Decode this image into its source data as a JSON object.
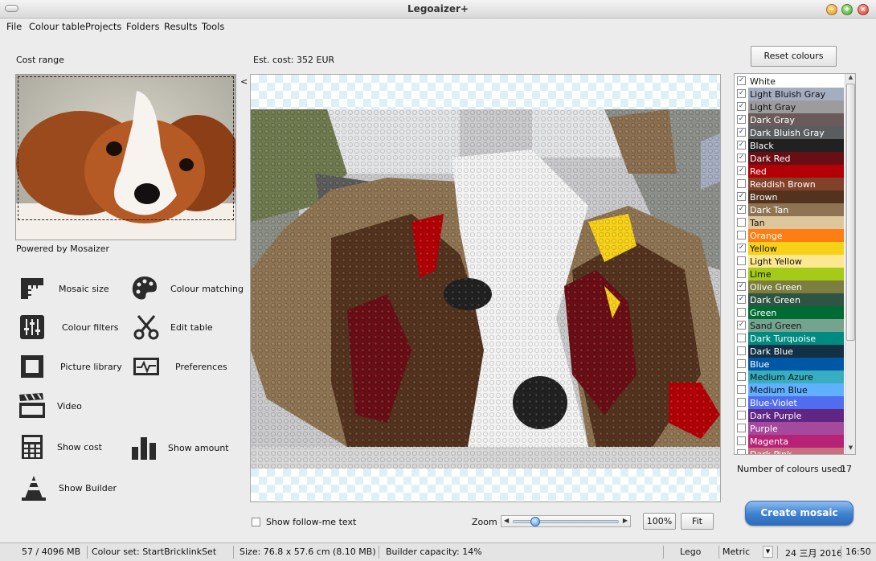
{
  "window": {
    "title": "Legoaizer+"
  },
  "menu": [
    "File",
    "Colour table",
    "Projects",
    "Folders",
    "Results",
    "Tools"
  ],
  "left": {
    "cost_range_label": "Cost range",
    "powered_by": "Powered by Mosaizer",
    "tools": [
      {
        "label": "Mosaic size",
        "icon": "ruler-icon"
      },
      {
        "label": "Colour matching",
        "icon": "palette-icon"
      },
      {
        "label": "Colour filters",
        "icon": "sliders-icon"
      },
      {
        "label": "Edit table",
        "icon": "scissors-icon"
      },
      {
        "label": "Picture library",
        "icon": "picture-frame-icon"
      },
      {
        "label": "Preferences",
        "icon": "monitor-pulse-icon"
      },
      {
        "label": "Video",
        "icon": "clapperboard-icon"
      },
      {
        "label": "Show cost",
        "icon": "calculator-icon"
      },
      {
        "label": "Show amount",
        "icon": "bar-chart-icon"
      },
      {
        "label": "Show Builder",
        "icon": "traffic-cone-icon"
      }
    ]
  },
  "center": {
    "est_cost": "Est. cost: 352 EUR",
    "collapse_arrow": "<",
    "show_follow_label": "Show follow-me text",
    "show_follow_checked": false,
    "zoom_label": "Zoom",
    "zoom_fraction": 0.18,
    "zoom_percent_button": "100%",
    "fit_button": "Fit"
  },
  "right": {
    "reset_button": "Reset colours",
    "colours": [
      {
        "name": "White",
        "color": "#ffffff",
        "text": "#111111",
        "checked": true
      },
      {
        "name": "Light Bluish Gray",
        "color": "#a5adc0",
        "text": "#111111",
        "checked": true
      },
      {
        "name": "Light Gray",
        "color": "#9c9c9c",
        "text": "#111111",
        "checked": true
      },
      {
        "name": "Dark Gray",
        "color": "#6b5a5a",
        "text": "#ffffff",
        "checked": true
      },
      {
        "name": "Dark Bluish Gray",
        "color": "#595d60",
        "text": "#ffffff",
        "checked": true
      },
      {
        "name": "Black",
        "color": "#212121",
        "text": "#ffffff",
        "checked": true
      },
      {
        "name": "Dark Red",
        "color": "#6a0e15",
        "text": "#ffffff",
        "checked": true
      },
      {
        "name": "Red",
        "color": "#b30006",
        "text": "#ffffff",
        "checked": true
      },
      {
        "name": "Reddish Brown",
        "color": "#82422a",
        "text": "#ffffff",
        "checked": false
      },
      {
        "name": "Brown",
        "color": "#53331e",
        "text": "#ffffff",
        "checked": true
      },
      {
        "name": "Dark Tan",
        "color": "#8e7452",
        "text": "#ffffff",
        "checked": true
      },
      {
        "name": "Tan",
        "color": "#dec69c",
        "text": "#111111",
        "checked": false
      },
      {
        "name": "Orange",
        "color": "#ff7e14",
        "text": "#ffffff",
        "checked": false
      },
      {
        "name": "Yellow",
        "color": "#f7d117",
        "text": "#111111",
        "checked": true
      },
      {
        "name": "Light Yellow",
        "color": "#fbe890",
        "text": "#111111",
        "checked": false
      },
      {
        "name": "Lime",
        "color": "#a5ca18",
        "text": "#111111",
        "checked": false
      },
      {
        "name": "Olive Green",
        "color": "#7b7e3e",
        "text": "#ffffff",
        "checked": true
      },
      {
        "name": "Dark Green",
        "color": "#2e5543",
        "text": "#ffffff",
        "checked": true
      },
      {
        "name": "Green",
        "color": "#006b32",
        "text": "#ffffff",
        "checked": false
      },
      {
        "name": "Sand Green",
        "color": "#76a290",
        "text": "#111111",
        "checked": true
      },
      {
        "name": "Dark Turquoise",
        "color": "#008a80",
        "text": "#ffffff",
        "checked": false
      },
      {
        "name": "Dark Blue",
        "color": "#143044",
        "text": "#ffffff",
        "checked": false
      },
      {
        "name": "Blue",
        "color": "#0057a6",
        "text": "#ffffff",
        "checked": false
      },
      {
        "name": "Medium Azure",
        "color": "#36aebf",
        "text": "#111111",
        "checked": false
      },
      {
        "name": "Medium Blue",
        "color": "#61afff",
        "text": "#111111",
        "checked": false
      },
      {
        "name": "Blue-Violet",
        "color": "#506cef",
        "text": "#ffffff",
        "checked": false
      },
      {
        "name": "Dark Purple",
        "color": "#5f2683",
        "text": "#ffffff",
        "checked": false
      },
      {
        "name": "Purple",
        "color": "#a5499c",
        "text": "#ffffff",
        "checked": false
      },
      {
        "name": "Magenta",
        "color": "#b72276",
        "text": "#ffffff",
        "checked": false
      },
      {
        "name": "Dark Pink",
        "color": "#c87080",
        "text": "#ffffff",
        "checked": false
      }
    ],
    "colours_used_label": "Number of colours used:",
    "colours_used_value": "17",
    "create_button": "Create mosaic"
  },
  "status": {
    "memory": "57 / 4096 MB",
    "colour_set": "Colour set: StartBricklinkSet",
    "size": "Size: 76.8 x 57.6 cm (8.10 MB)",
    "capacity": "Builder capacity: 14%",
    "brand": "Lego",
    "units": "Metric",
    "date": "24 三月 2016",
    "time": "16:50"
  }
}
